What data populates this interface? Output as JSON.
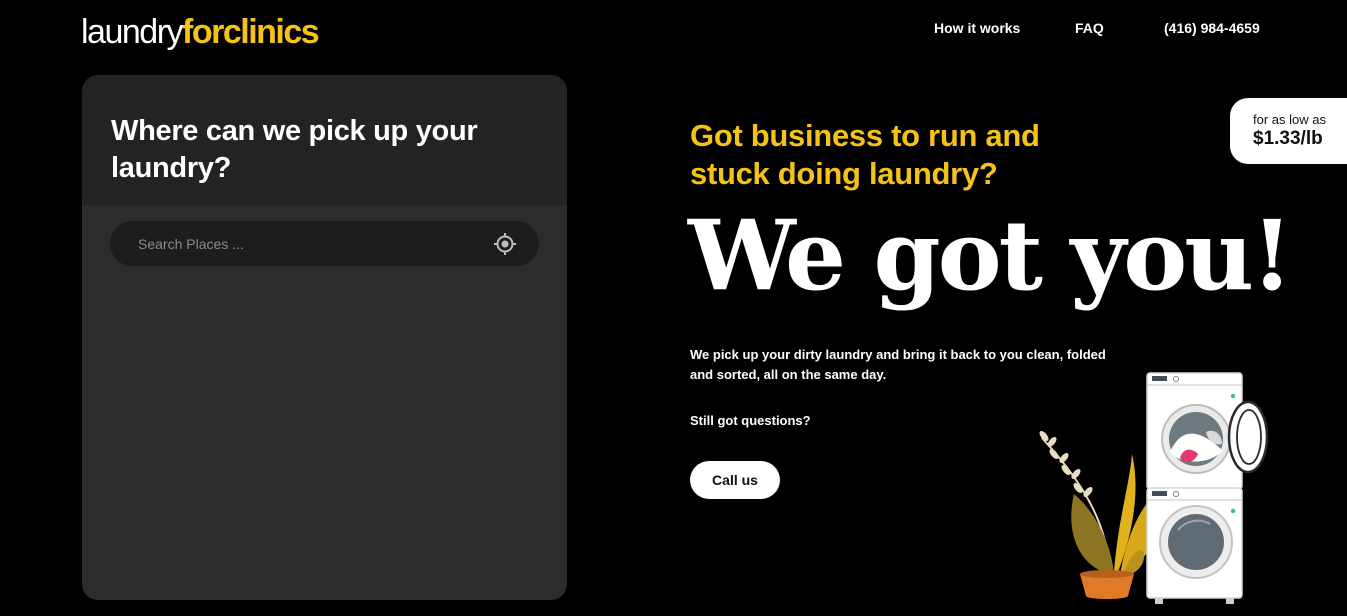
{
  "header": {
    "logo_light": "laundry",
    "logo_bold": "forclinics",
    "nav": {
      "how": "How it works",
      "faq": "FAQ",
      "phone": "(416) 984-4659"
    }
  },
  "panel": {
    "title": "Where can we pick up your laundry?",
    "search_placeholder": "Search Places ..."
  },
  "hero": {
    "tagline": "Got business to run and stuck doing laundry?",
    "headline": "We got you!",
    "description": "We pick up your dirty laundry and bring it back to you clean, folded and sorted, all on the same day.",
    "question": "Still got questions?",
    "cta": "Call us"
  },
  "price_badge": {
    "prefix": "for as low as",
    "value": "$1.33/lb"
  },
  "colors": {
    "accent": "#f5c316",
    "background": "#000000",
    "panel": "#2c2c2c",
    "panel_header": "#232323"
  }
}
